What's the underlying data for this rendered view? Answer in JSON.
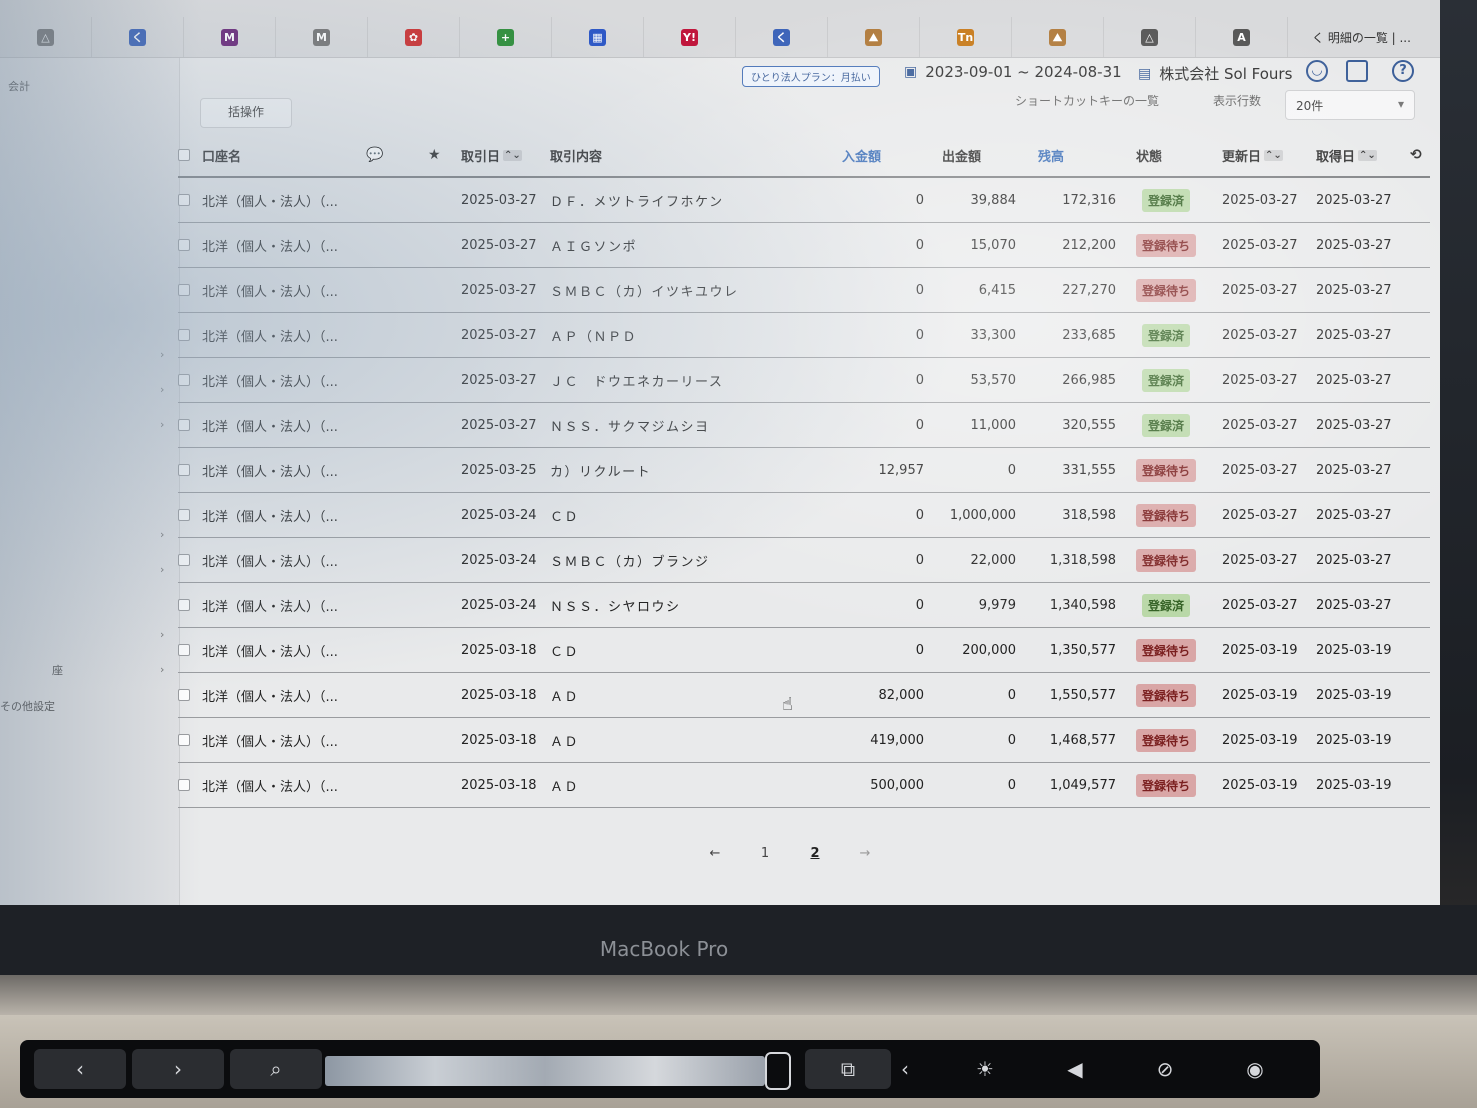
{
  "bookmarks": [
    "△",
    "く",
    "M",
    "M",
    "✿",
    "+",
    "▦",
    "Y!",
    "く",
    "⛰",
    "Tn",
    "⛰",
    "△",
    "A"
  ],
  "bookmarks_last": "く 明細の一覧 | ...",
  "sidebar": {
    "top_label": "会計",
    "bottom_label_1": "座",
    "bottom_label_2": "その他設定"
  },
  "header": {
    "plan_badge": "ひとり法人プラン：月払い",
    "period": "2023-09-01 ~ 2024-08-31",
    "company": "株式会社 Sol Fours"
  },
  "toolbar": {
    "bulk_button": "括操作",
    "shortcut_label": "ショートカットキーの一覧",
    "rows_label": "表示行数",
    "rows_value": "20件"
  },
  "columns": {
    "account": "口座名",
    "trade_date": "取引日",
    "description": "取引内容",
    "deposit": "入金額",
    "withdrawal": "出金額",
    "balance": "残高",
    "status": "状態",
    "updated": "更新日",
    "acquired": "取得日"
  },
  "rows": [
    {
      "account": "北洋（個人・法人）（...",
      "date": "2025-03-27",
      "desc": "ＤＦ．メツトライフホケン",
      "deposit": "0",
      "withdrawal": "39,884",
      "balance": "172,316",
      "status": "登録済",
      "kind": "done",
      "updated": "2025-03-27",
      "acquired": "2025-03-27"
    },
    {
      "account": "北洋（個人・法人）（...",
      "date": "2025-03-27",
      "desc": "ＡＩＧソンポ",
      "deposit": "0",
      "withdrawal": "15,070",
      "balance": "212,200",
      "status": "登録待ち",
      "kind": "wait",
      "updated": "2025-03-27",
      "acquired": "2025-03-27"
    },
    {
      "account": "北洋（個人・法人）（...",
      "date": "2025-03-27",
      "desc": "ＳＭＢＣ（カ）イツキユウレ",
      "deposit": "0",
      "withdrawal": "6,415",
      "balance": "227,270",
      "status": "登録待ち",
      "kind": "wait",
      "updated": "2025-03-27",
      "acquired": "2025-03-27"
    },
    {
      "account": "北洋（個人・法人）（...",
      "date": "2025-03-27",
      "desc": "ＡＰ（ＮＰＤ",
      "deposit": "0",
      "withdrawal": "33,300",
      "balance": "233,685",
      "status": "登録済",
      "kind": "done",
      "updated": "2025-03-27",
      "acquired": "2025-03-27"
    },
    {
      "account": "北洋（個人・法人）（...",
      "date": "2025-03-27",
      "desc": "ＪＣ　ドウエネカーリース",
      "deposit": "0",
      "withdrawal": "53,570",
      "balance": "266,985",
      "status": "登録済",
      "kind": "done",
      "updated": "2025-03-27",
      "acquired": "2025-03-27"
    },
    {
      "account": "北洋（個人・法人）（...",
      "date": "2025-03-27",
      "desc": "ＮＳＳ．サクマジムシヨ",
      "deposit": "0",
      "withdrawal": "11,000",
      "balance": "320,555",
      "status": "登録済",
      "kind": "done",
      "updated": "2025-03-27",
      "acquired": "2025-03-27"
    },
    {
      "account": "北洋（個人・法人）（...",
      "date": "2025-03-25",
      "desc": "カ）リクルート",
      "deposit": "12,957",
      "withdrawal": "0",
      "balance": "331,555",
      "status": "登録待ち",
      "kind": "wait",
      "updated": "2025-03-27",
      "acquired": "2025-03-27"
    },
    {
      "account": "北洋（個人・法人）（...",
      "date": "2025-03-24",
      "desc": "ＣＤ",
      "deposit": "0",
      "withdrawal": "1,000,000",
      "balance": "318,598",
      "status": "登録待ち",
      "kind": "wait",
      "updated": "2025-03-27",
      "acquired": "2025-03-27"
    },
    {
      "account": "北洋（個人・法人）（...",
      "date": "2025-03-24",
      "desc": "ＳＭＢＣ（カ）ブランジ",
      "deposit": "0",
      "withdrawal": "22,000",
      "balance": "1,318,598",
      "status": "登録待ち",
      "kind": "wait",
      "updated": "2025-03-27",
      "acquired": "2025-03-27"
    },
    {
      "account": "北洋（個人・法人）（...",
      "date": "2025-03-24",
      "desc": "ＮＳＳ．シヤロウシ",
      "deposit": "0",
      "withdrawal": "9,979",
      "balance": "1,340,598",
      "status": "登録済",
      "kind": "done",
      "updated": "2025-03-27",
      "acquired": "2025-03-27"
    },
    {
      "account": "北洋（個人・法人）（...",
      "date": "2025-03-18",
      "desc": "ＣＤ",
      "deposit": "0",
      "withdrawal": "200,000",
      "balance": "1,350,577",
      "status": "登録待ち",
      "kind": "wait",
      "updated": "2025-03-19",
      "acquired": "2025-03-19"
    },
    {
      "account": "北洋（個人・法人）（...",
      "date": "2025-03-18",
      "desc": "ＡＤ",
      "deposit": "82,000",
      "withdrawal": "0",
      "balance": "1,550,577",
      "status": "登録待ち",
      "kind": "wait",
      "updated": "2025-03-19",
      "acquired": "2025-03-19"
    },
    {
      "account": "北洋（個人・法人）（...",
      "date": "2025-03-18",
      "desc": "ＡＤ",
      "deposit": "419,000",
      "withdrawal": "0",
      "balance": "1,468,577",
      "status": "登録待ち",
      "kind": "wait",
      "updated": "2025-03-19",
      "acquired": "2025-03-19"
    },
    {
      "account": "北洋（個人・法人）（...",
      "date": "2025-03-18",
      "desc": "ＡＤ",
      "deposit": "500,000",
      "withdrawal": "0",
      "balance": "1,049,577",
      "status": "登録待ち",
      "kind": "wait",
      "updated": "2025-03-19",
      "acquired": "2025-03-19"
    }
  ],
  "pagination": {
    "prev": "←",
    "pages": [
      "1",
      "2"
    ],
    "current": "2",
    "next": "→"
  },
  "laptop": {
    "brand": "MacBook Pro"
  },
  "colors": {
    "registered": "#b8d7a6",
    "pending": "#d9a6a6",
    "accent": "#3c5f99"
  }
}
